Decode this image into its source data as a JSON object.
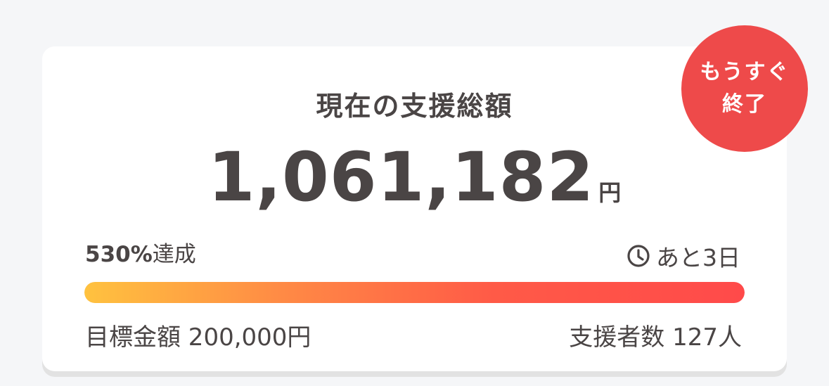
{
  "badge": {
    "line1": "もうすぐ",
    "line2": "終了"
  },
  "title": "現在の支援総額",
  "amount": "1,061,182",
  "currency": "円",
  "achievement": {
    "percent": "530%",
    "suffix": "達成"
  },
  "progress": {
    "fill_fraction": 1.0
  },
  "remaining": {
    "icon": "clock-icon",
    "text": "あと3日"
  },
  "goal": {
    "text": "目標金額 200,000円"
  },
  "supporters": {
    "text": "支援者数 127人"
  },
  "colors": {
    "badge": "#ee4a4a",
    "text": "#4a4545",
    "bar_start": "#ffc23f",
    "bar_end": "#ff4a4a"
  }
}
